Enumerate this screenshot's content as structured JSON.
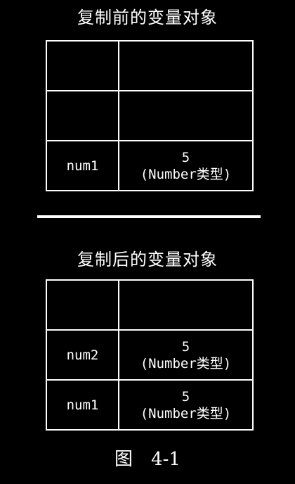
{
  "before": {
    "title": "复制前的变量对象",
    "rows": [
      {
        "name": "",
        "value": "",
        "type": ""
      },
      {
        "name": "",
        "value": "",
        "type": ""
      },
      {
        "name": "num1",
        "value": "5",
        "type": "(Number类型)"
      }
    ]
  },
  "after": {
    "title": "复制后的变量对象",
    "rows": [
      {
        "name": "",
        "value": "",
        "type": ""
      },
      {
        "name": "num2",
        "value": "5",
        "type": "(Number类型)"
      },
      {
        "name": "num1",
        "value": "5",
        "type": "(Number类型)"
      }
    ]
  },
  "caption": {
    "word": "图",
    "number": "4-1"
  }
}
